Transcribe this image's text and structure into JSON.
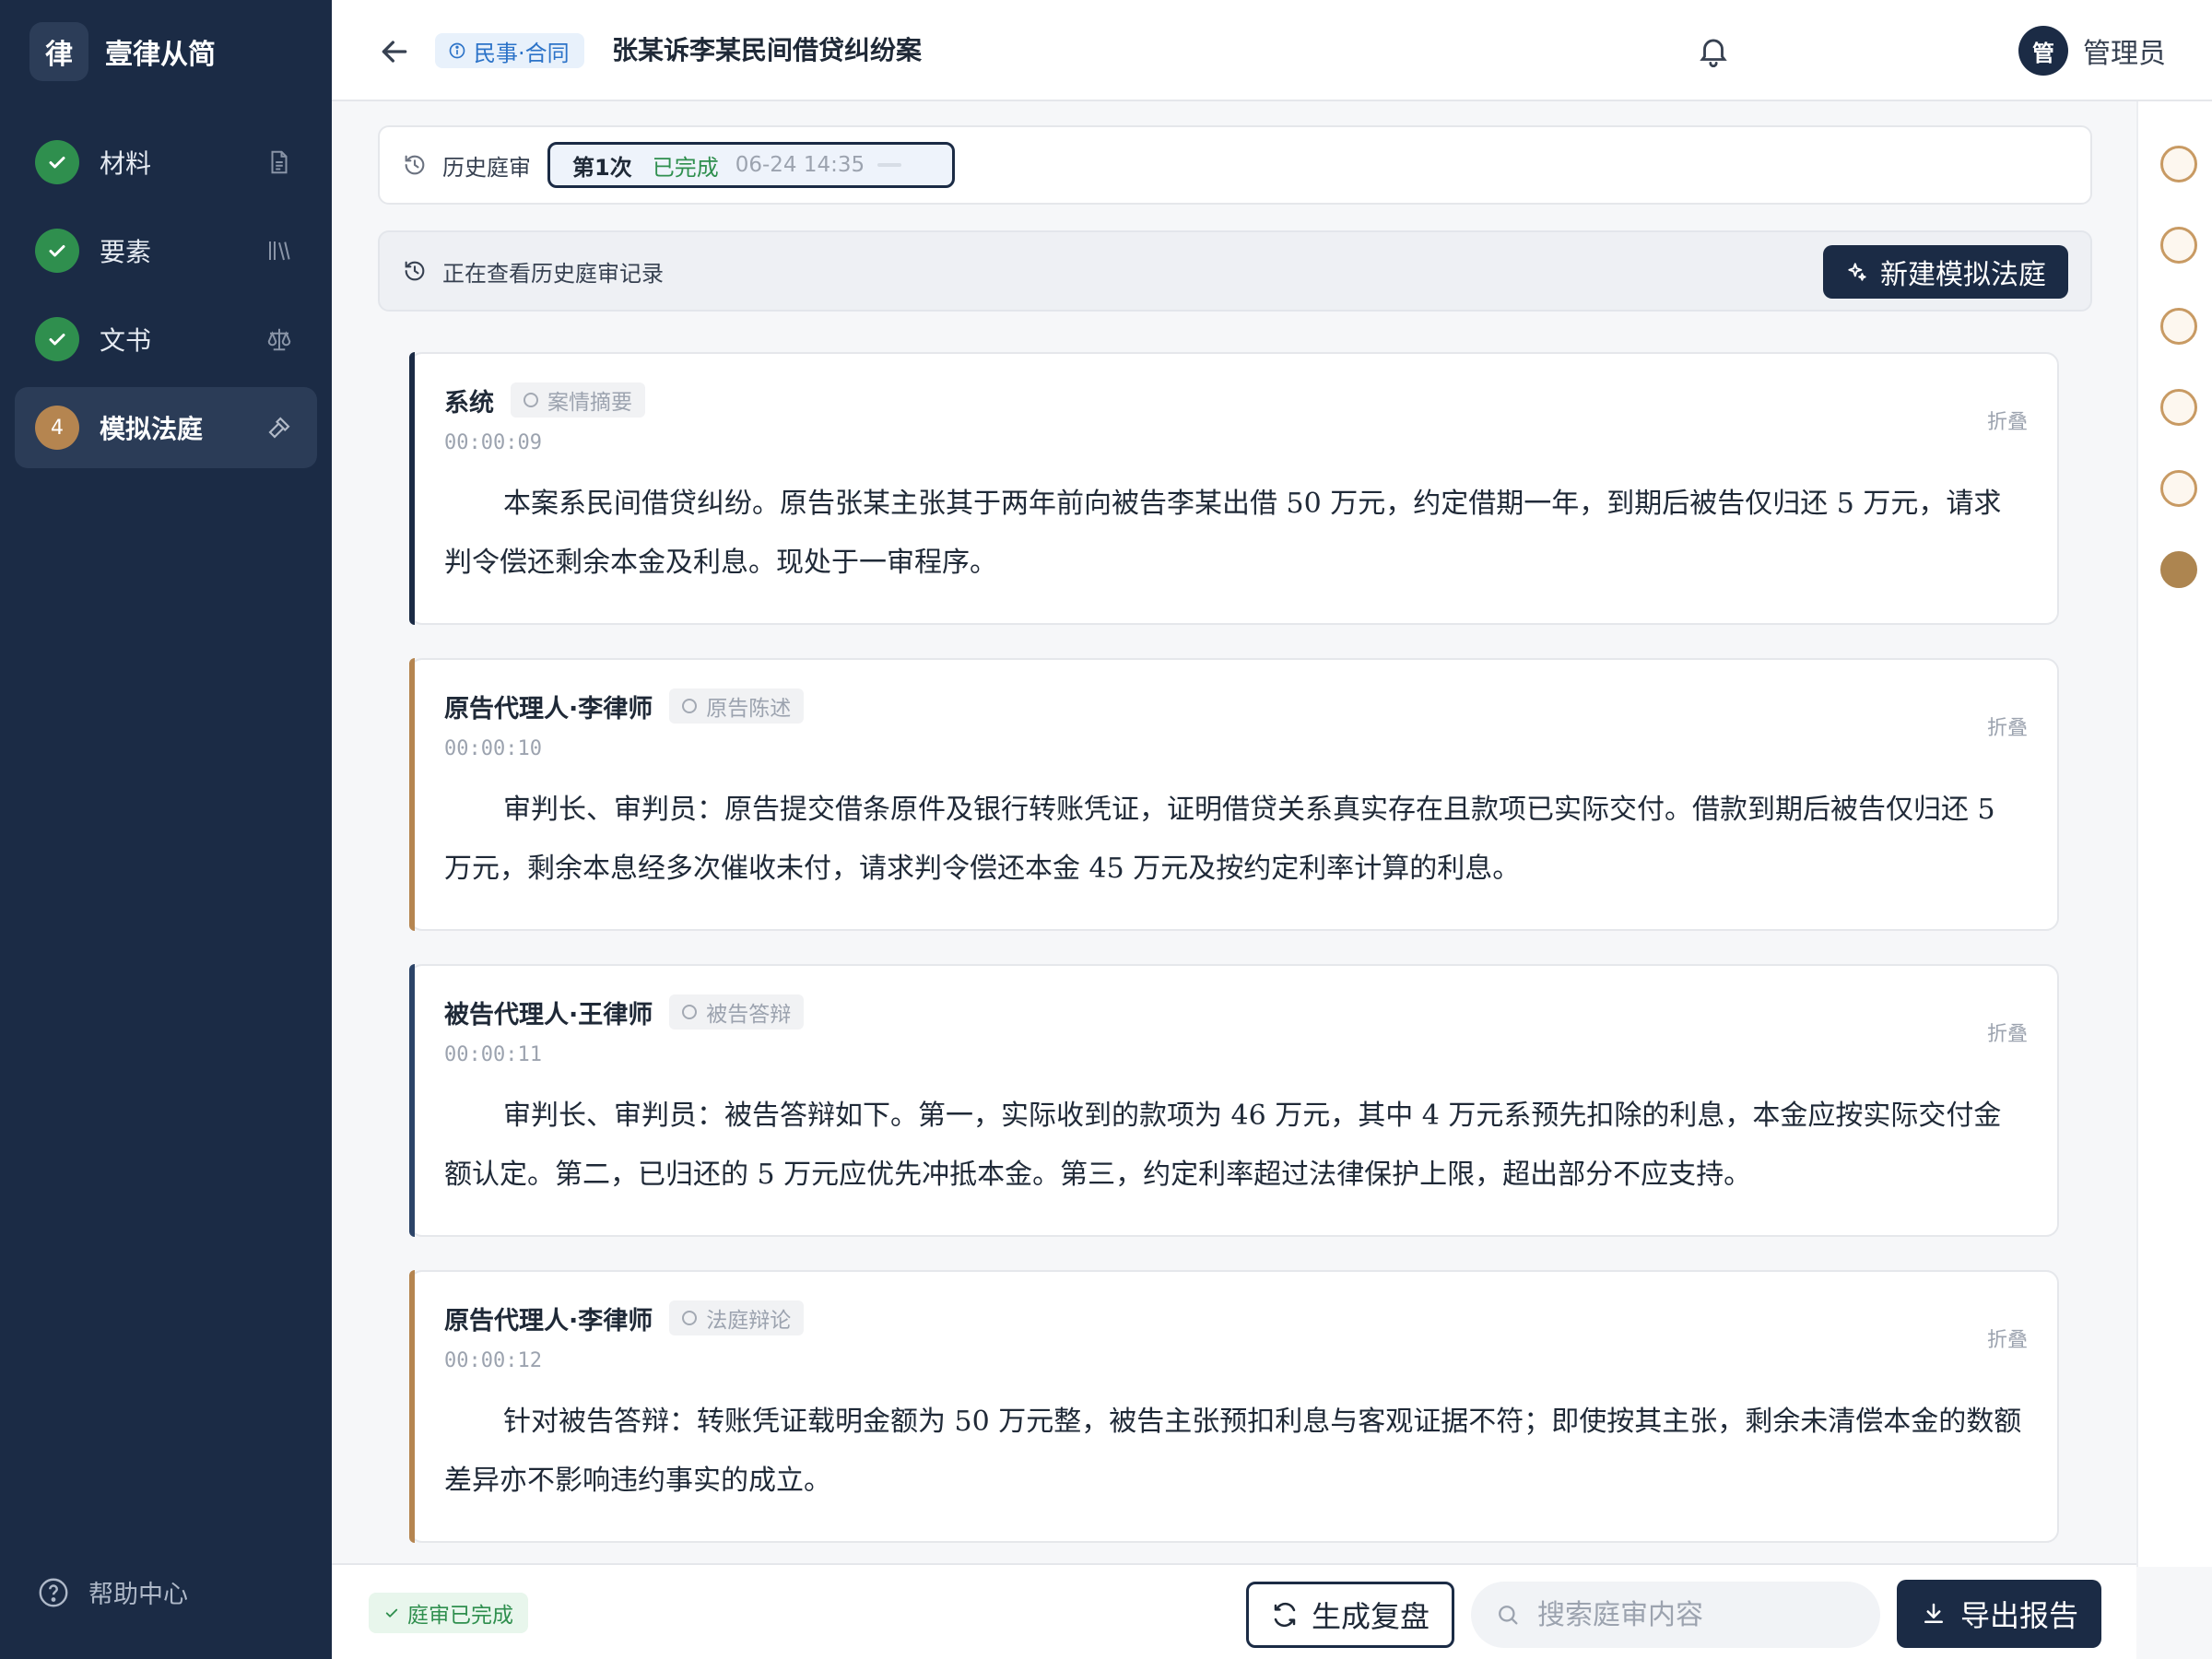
{
  "app": {
    "logo_char": "律",
    "name": "壹律从简"
  },
  "sidebar": {
    "items": [
      {
        "label": "材料",
        "state": "done",
        "icon": "file-icon"
      },
      {
        "label": "要素",
        "state": "done",
        "icon": "library-icon"
      },
      {
        "label": "文书",
        "state": "done",
        "icon": "scale-icon"
      },
      {
        "label": "模拟法庭",
        "state": "active",
        "badge": "4",
        "icon": "gavel-icon"
      }
    ],
    "help": "帮助中心"
  },
  "header": {
    "case_tag": "民事·合同",
    "case_title": "张某诉李某民间借贷纠纷案",
    "user_avatar": "管",
    "user_name": "管理员"
  },
  "history": {
    "label": "历史庭审",
    "session": {
      "num": "第1次",
      "status": "已完成",
      "time": "06-24 14:35"
    }
  },
  "viewing": {
    "text": "正在查看历史庭审记录",
    "new_button": "新建模拟法庭"
  },
  "transcript": [
    {
      "speaker": "系统",
      "stage": "案情摘要",
      "time": "00:00:09",
      "fold": "折叠",
      "accent": "#1b2b45",
      "content": "本案系民间借贷纠纷。原告张某主张其于两年前向被告李某出借 50 万元，约定借期一年，到期后被告仅归还 5 万元，请求判令偿还剩余本金及利息。现处于一审程序。"
    },
    {
      "speaker": "原告代理人·李律师",
      "stage": "原告陈述",
      "time": "00:00:10",
      "fold": "折叠",
      "accent": "#b58550",
      "content": "审判长、审判员：原告提交借条原件及银行转账凭证，证明借贷关系真实存在且款项已实际交付。借款到期后被告仅归还 5 万元，剩余本息经多次催收未付，请求判令偿还本金 45 万元及按约定利率计算的利息。"
    },
    {
      "speaker": "被告代理人·王律师",
      "stage": "被告答辩",
      "time": "00:00:11",
      "fold": "折叠",
      "accent": "#2c4468",
      "content": "审判长、审判员：被告答辩如下。第一，实际收到的款项为 46 万元，其中 4 万元系预先扣除的利息，本金应按实际交付金额认定。第二，已归还的 5 万元应优先冲抵本金。第三，约定利率超过法律保护上限，超出部分不应支持。"
    },
    {
      "speaker": "原告代理人·李律师",
      "stage": "法庭辩论",
      "time": "00:00:12",
      "fold": "折叠",
      "accent": "#b58550",
      "content": "针对被告答辩：转账凭证载明金额为 50 万元整，被告主张预扣利息与客观证据不符；即使按其主张，剩余未清偿本金的数额差异亦不影响违约事实的成立。"
    }
  ],
  "timeline": {
    "dots": 6,
    "active_index": 5
  },
  "footer": {
    "status": "庭审已完成",
    "review_button": "生成复盘",
    "search_placeholder": "搜索庭审内容",
    "export_button": "导出报告"
  }
}
